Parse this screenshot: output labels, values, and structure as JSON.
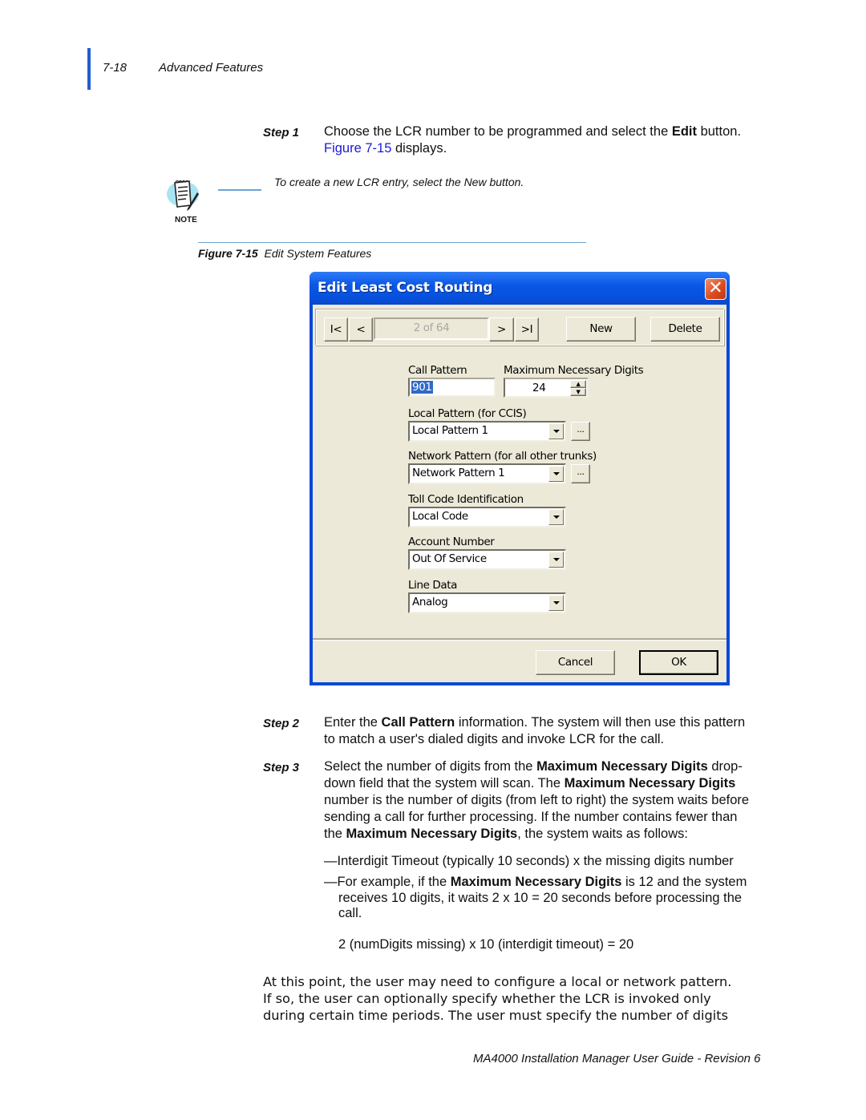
{
  "header": {
    "page_number": "7-18",
    "section_title": "Advanced Features"
  },
  "step1": {
    "label": "Step 1",
    "text_before": "Choose the LCR number to be programmed and select the ",
    "bold": "Edit",
    "text_after": " button.",
    "link": "Figure 7-15",
    "line2_after": " displays."
  },
  "note": {
    "icon_label": "NOTE",
    "text": "To create a new LCR entry, select the New button."
  },
  "figure": {
    "label": "Figure 7-15",
    "caption": "Edit System Features"
  },
  "dialog": {
    "title": "Edit Least Cost Routing",
    "close_glyph": "✕",
    "nav": {
      "first": "I<",
      "prev": "<",
      "record": "2 of 64",
      "next": ">",
      "last": ">I",
      "new": "New",
      "delete": "Delete"
    },
    "fields": {
      "call_pattern": {
        "label": "Call Pattern",
        "value": "901"
      },
      "max_digits": {
        "label": "Maximum Necessary Digits",
        "value": "24"
      },
      "local_pattern": {
        "label": "Local Pattern (for CCIS)",
        "value": "Local Pattern 1",
        "browse": "..."
      },
      "network_pattern": {
        "label": "Network Pattern (for all other trunks)",
        "value": "Network Pattern 1",
        "browse": "..."
      },
      "toll_code": {
        "label": "Toll Code Identification",
        "value": "Local Code"
      },
      "account_number": {
        "label": "Account Number",
        "value": "Out Of Service"
      },
      "line_data": {
        "label": "Line Data",
        "value": "Analog"
      }
    },
    "buttons": {
      "cancel": "Cancel",
      "ok": "OK"
    }
  },
  "step2": {
    "label": "Step 2",
    "t1": "Enter the ",
    "b1": "Call Pattern",
    "t2": " information. The system will then use this pattern",
    "line2": "to match a user's dialed digits and invoke LCR for the call."
  },
  "step3": {
    "label": "Step 3",
    "l1a": "Select the number of digits from the ",
    "l1b": "Maximum Necessary Digits",
    "l1c": " drop-",
    "l2a": "down field that the system will scan. The ",
    "l2b": "Maximum Necessary Digits",
    "l3": "number is the number of digits (from left to right) the system waits before",
    "l4": "sending a call for further processing. If the number contains fewer than",
    "l5a": "the ",
    "l5b": "Maximum Necessary Digits",
    "l5c": ", the system waits as follows:"
  },
  "bullets": {
    "b1": "—Interdigit Timeout (typically 10 seconds) x the missing digits number",
    "b2a": "—For example, if the ",
    "b2b": "Maximum Necessary Digits",
    "b2c": " is 12 and the system",
    "b2l2": "receives 10 digits, it waits 2 x 10 = 20 seconds before processing the",
    "b2l3": "call.",
    "formula": "2 (numDigits missing) x 10 (interdigit timeout) = 20"
  },
  "paragraph": {
    "l1": "At this point, the user may need to configure a local or network pattern.",
    "l2": "If so, the user can optionally specify whether the LCR is invoked only",
    "l3": "during certain time periods. The user must specify the number of digits"
  },
  "footer": "MA4000 Installation Manager User Guide - Revision 6"
}
